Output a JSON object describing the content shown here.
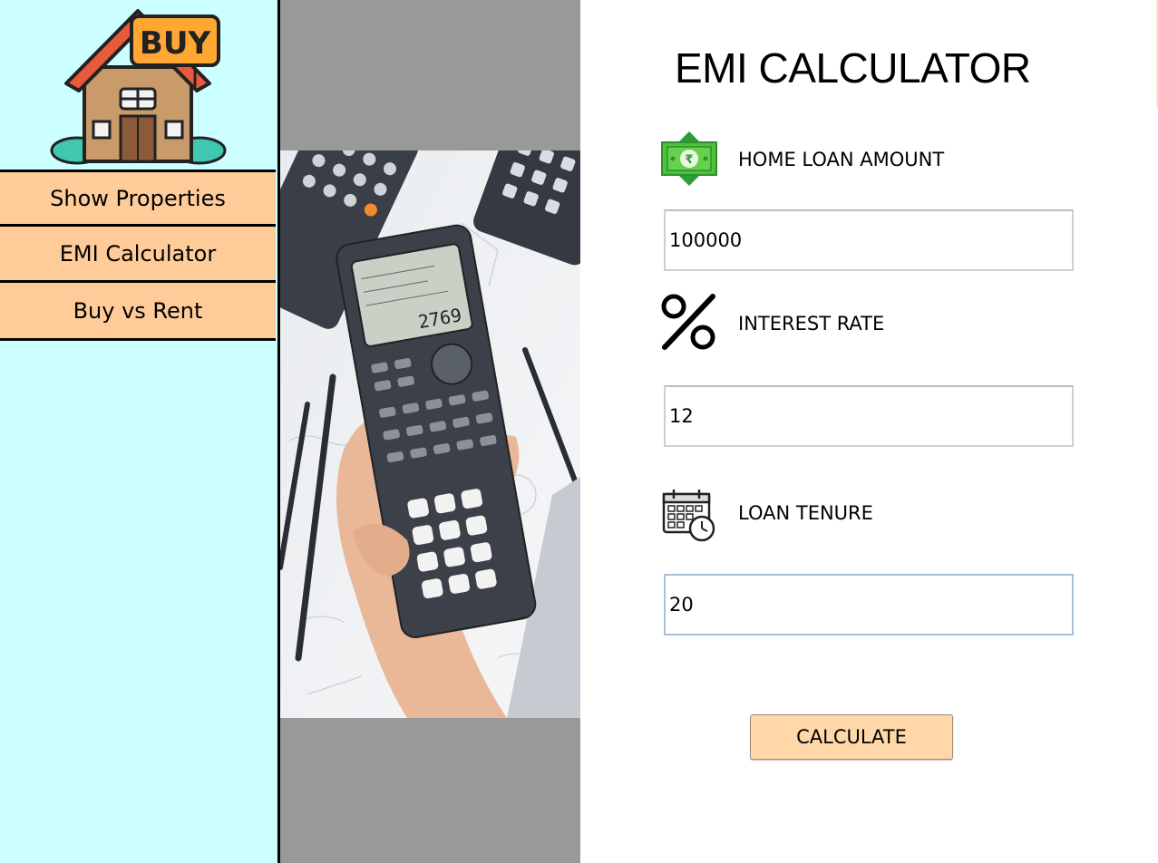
{
  "sidebar": {
    "logo_text": "BUY",
    "items": [
      {
        "label": "Show Properties"
      },
      {
        "label": "EMI Calculator"
      },
      {
        "label": "Buy vs Rent"
      }
    ]
  },
  "main": {
    "title": "EMI CALCULATOR",
    "fields": [
      {
        "label": "HOME LOAN AMOUNT",
        "value": "100000",
        "icon": "money-icon"
      },
      {
        "label": "INTEREST RATE",
        "value": "12",
        "icon": "percent-icon"
      },
      {
        "label": "LOAN TENURE",
        "value": "20",
        "icon": "calendar-clock-icon"
      }
    ],
    "calculate_label": "CALCULATE",
    "calculator_display": "2769"
  },
  "colors": {
    "sidebar_bg": "#ccffff",
    "nav_button_bg": "#ffcc99",
    "image_panel_bg": "#999999",
    "calculate_bg": "#ffd7a8"
  }
}
